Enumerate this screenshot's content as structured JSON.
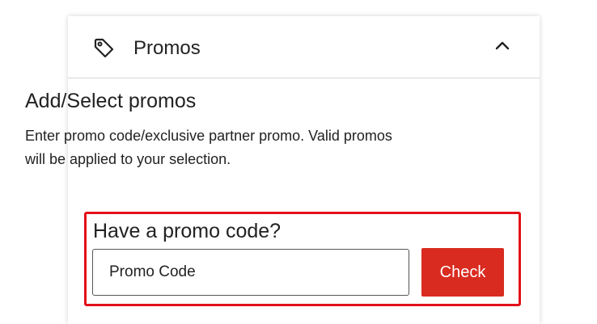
{
  "promos_panel": {
    "title": "Promos",
    "icon": "tag-icon",
    "toggle_icon": "chevron-up-icon",
    "heading": "Add/Select promos",
    "description": "Enter promo code/exclusive partner promo. Valid promos will be applied to your selection.",
    "promo_code": {
      "label": "Have a promo code?",
      "placeholder": "Promo Code",
      "value": "",
      "button_label": "Check"
    }
  },
  "colors": {
    "accent": "#d92b20",
    "highlight_border": "#e3101a",
    "text": "#222222",
    "divider": "#d6d6d6"
  }
}
